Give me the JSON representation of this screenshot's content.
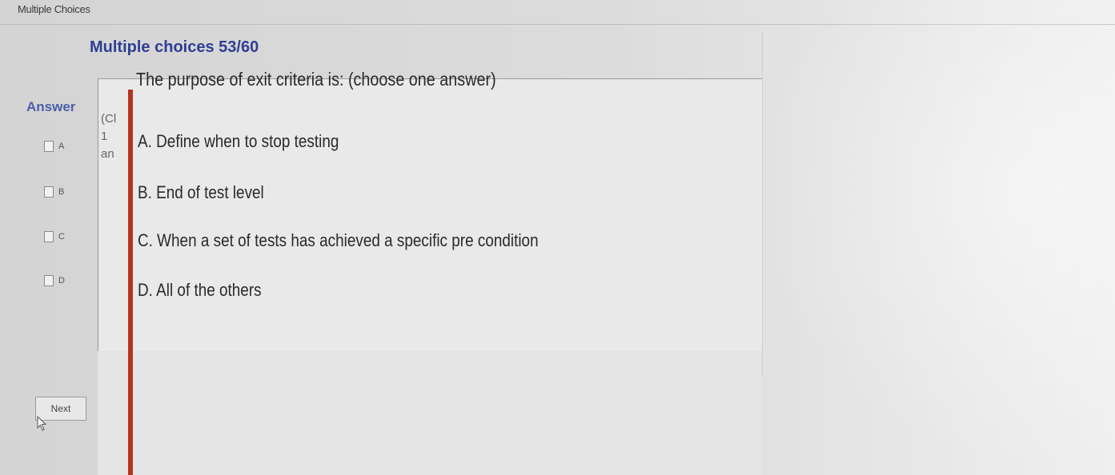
{
  "window": {
    "title": "Multiple Choices"
  },
  "header": {
    "counter": "Multiple choices 53/60"
  },
  "answer_panel": {
    "heading": "Answer",
    "options": [
      {
        "label": "A",
        "checked": false
      },
      {
        "label": "B",
        "checked": false
      },
      {
        "label": "C",
        "checked": false
      },
      {
        "label": "D",
        "checked": false
      }
    ],
    "next_label": "Next"
  },
  "side_strip": {
    "line1": "(Cl",
    "line2": "1",
    "line3": "an"
  },
  "question": {
    "text": "The purpose of exit criteria is: (choose one answer)",
    "options": [
      "A. Define when to stop testing",
      "B. End of test level",
      "C. When a set of tests has achieved a specific pre condition",
      "D. All of the others"
    ]
  },
  "colors": {
    "counter": "#2e3f93",
    "answer_heading": "#4a5fa8",
    "accent_bar": "#b5341f",
    "text": "#2a2a2a"
  },
  "icons": {
    "cursor": "mouse-pointer-icon",
    "checkbox": "checkbox-icon"
  }
}
